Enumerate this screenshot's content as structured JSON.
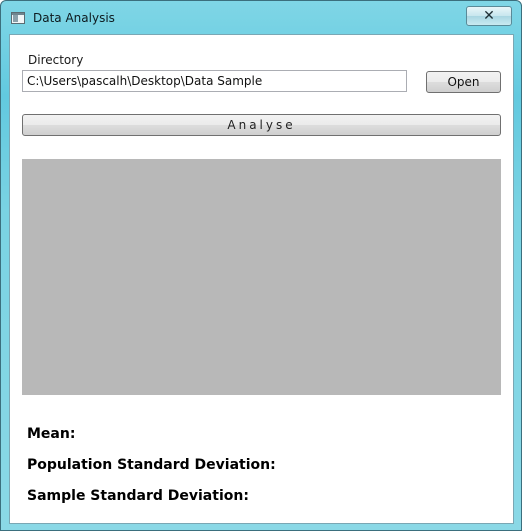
{
  "window": {
    "title": "Data Analysis",
    "close_glyph": "✕"
  },
  "directory": {
    "label": "Directory",
    "value": "C:\\Users\\pascalh\\Desktop\\Data Sample"
  },
  "buttons": {
    "open_label": "Open",
    "analyse_label": "Analyse"
  },
  "results": {
    "mean_label": "Mean:",
    "population_sd_label": "Population Standard Deviation:",
    "sample_sd_label": "Sample Standard Deviation:"
  },
  "colors": {
    "titlebar_accent": "#62c9df",
    "result_area": "#b8b8b8"
  },
  "icons": {
    "app_icon": "window-icon",
    "close_icon": "close-icon"
  }
}
